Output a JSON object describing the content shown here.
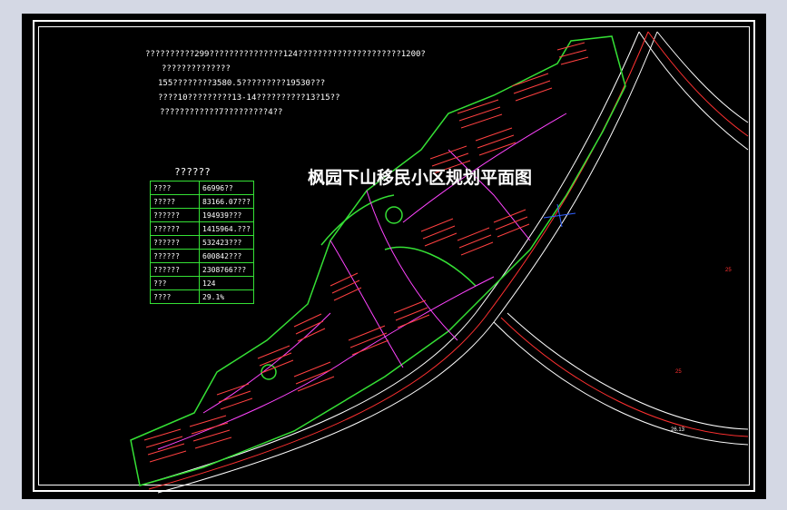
{
  "plan": {
    "title": "枫园下山移民小区规划平面图"
  },
  "notes": [
    "??????????299???????????????124?????????????????????1200?",
    "??????????????",
    "155????????3580.5?????????19530???",
    "????10?????????13-14??????????13?15??",
    "????????????7?????????4??"
  ],
  "table": {
    "title": "??????",
    "rows": [
      {
        "key": "????",
        "value": "66996??"
      },
      {
        "key": "?????",
        "value": "83166.07???"
      },
      {
        "key": "??????",
        "value": "194939???"
      },
      {
        "key": "??????",
        "value": "1415964.???"
      },
      {
        "key": "??????",
        "value": "532423???"
      },
      {
        "key": "??????",
        "value": "600842???"
      },
      {
        "key": "??????",
        "value": "2308766???"
      },
      {
        "key": "???",
        "value": "124"
      },
      {
        "key": "????",
        "value": "29.1%"
      }
    ]
  },
  "colors": {
    "background": "#000000",
    "frame": "#ffffff",
    "roads": "#ffffff",
    "road_center": "#ff3030",
    "boundary": "#35e035",
    "buildings": "#ff4040",
    "paths": "#ff44ff"
  },
  "elevation_labels": [
    "25",
    "25",
    "26.13"
  ]
}
